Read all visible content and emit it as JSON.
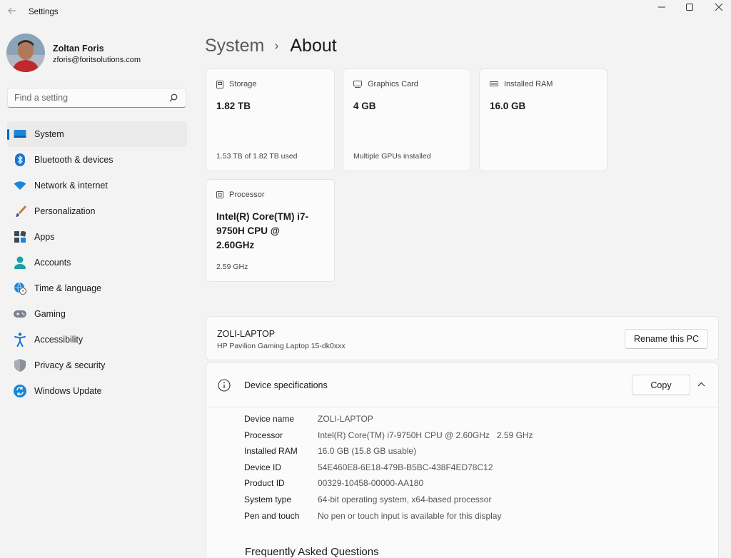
{
  "window": {
    "title": "Settings",
    "controls": [
      "minimize",
      "maximize",
      "close"
    ]
  },
  "profile": {
    "name": "Zoltan Foris",
    "email": "zforis@foritsolutions.com"
  },
  "search": {
    "placeholder": "Find a setting"
  },
  "sidebar": {
    "items": [
      {
        "label": "System",
        "icon": "system-icon",
        "active": true
      },
      {
        "label": "Bluetooth & devices",
        "icon": "bluetooth-icon"
      },
      {
        "label": "Network & internet",
        "icon": "wifi-icon"
      },
      {
        "label": "Personalization",
        "icon": "brush-icon"
      },
      {
        "label": "Apps",
        "icon": "apps-icon"
      },
      {
        "label": "Accounts",
        "icon": "person-icon"
      },
      {
        "label": "Time & language",
        "icon": "globe-clock-icon"
      },
      {
        "label": "Gaming",
        "icon": "gamepad-icon"
      },
      {
        "label": "Accessibility",
        "icon": "accessibility-icon"
      },
      {
        "label": "Privacy & security",
        "icon": "shield-icon"
      },
      {
        "label": "Windows Update",
        "icon": "update-icon"
      }
    ]
  },
  "breadcrumb": {
    "parent": "System",
    "separator": "›",
    "current": "About"
  },
  "cards": {
    "storage": {
      "label": "Storage",
      "value": "1.82 TB",
      "footer": "1.53 TB of 1.82 TB used"
    },
    "graphics": {
      "label": "Graphics Card",
      "value": "4 GB",
      "footer": "Multiple GPUs installed"
    },
    "ram": {
      "label": "Installed RAM",
      "value": "16.0 GB",
      "footer": ""
    },
    "processor": {
      "label": "Processor",
      "value": "Intel(R) Core(TM) i7-9750H CPU @ 2.60GHz",
      "footer": "2.59 GHz"
    }
  },
  "pc": {
    "name": "ZOLI-LAPTOP",
    "model": "HP Pavilion Gaming Laptop 15-dk0xxx",
    "rename_label": "Rename this PC"
  },
  "specs": {
    "title": "Device specifications",
    "copy_label": "Copy",
    "rows": [
      {
        "key": "Device name",
        "value": "ZOLI-LAPTOP"
      },
      {
        "key": "Processor",
        "value": "Intel(R) Core(TM) i7-9750H CPU @ 2.60GHz   2.59 GHz"
      },
      {
        "key": "Installed RAM",
        "value": "16.0 GB (15.8 GB usable)"
      },
      {
        "key": "Device ID",
        "value": "54E460E8-6E18-479B-B5BC-438F4ED78C12"
      },
      {
        "key": "Product ID",
        "value": "00329-10458-00000-AA180"
      },
      {
        "key": "System type",
        "value": "64-bit operating system, x64-based processor"
      },
      {
        "key": "Pen and touch",
        "value": "No pen or touch input is available for this display"
      }
    ]
  },
  "faq": {
    "title": "Frequently Asked Questions"
  },
  "colors": {
    "accent": "#0067c0",
    "background": "#f3f3f3",
    "card": "#fbfbfb"
  }
}
